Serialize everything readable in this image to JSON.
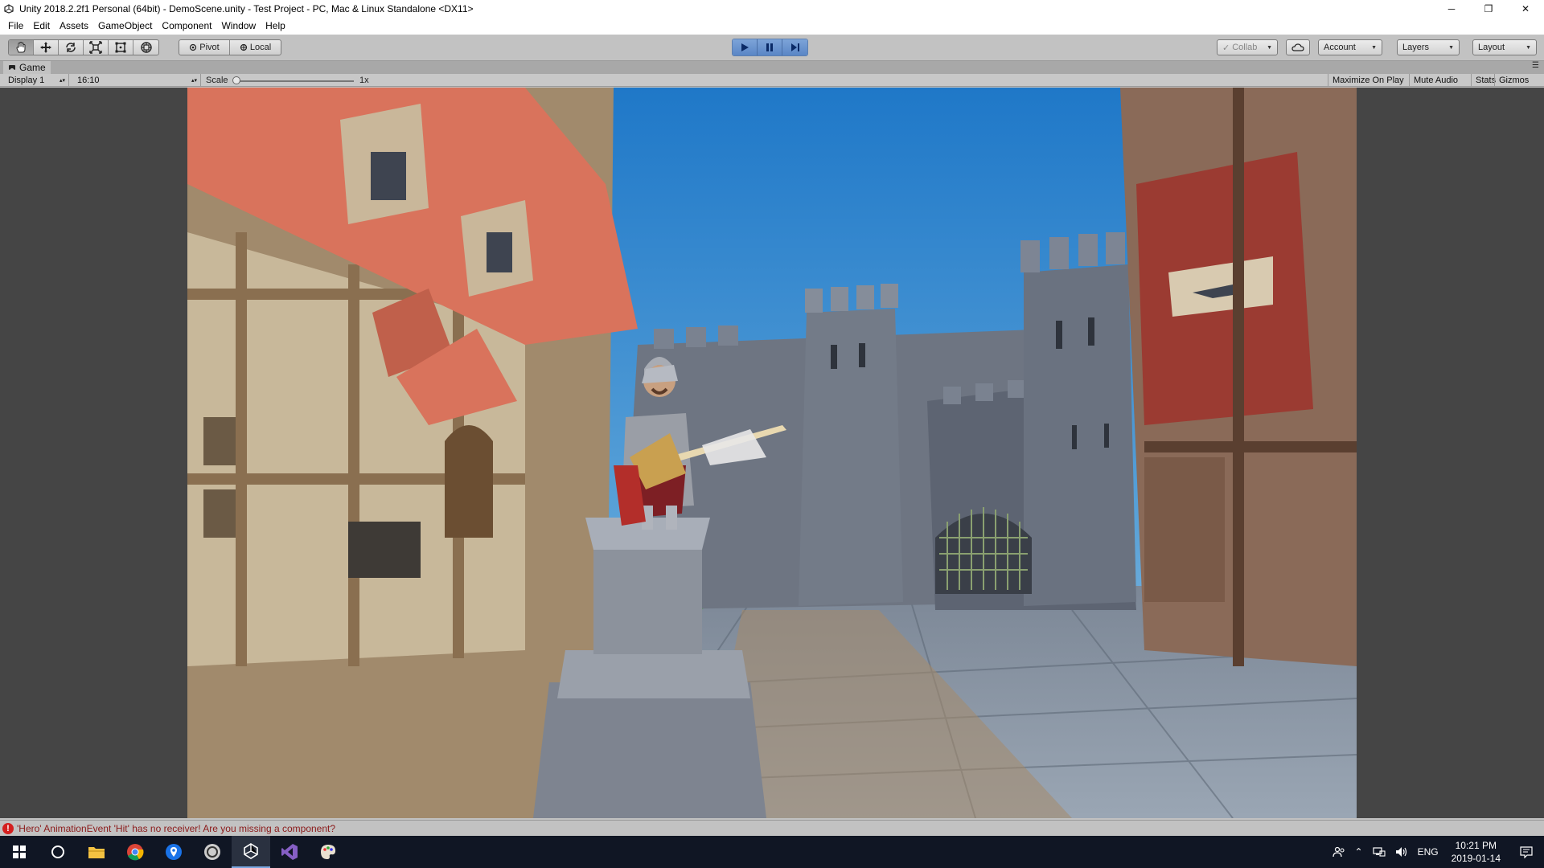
{
  "window": {
    "title": "Unity 2018.2.2f1 Personal (64bit) - DemoScene.unity - Test Project - PC, Mac & Linux Standalone <DX11>",
    "minimize": "─",
    "maximize": "❐",
    "close": "✕"
  },
  "menu": [
    "File",
    "Edit",
    "Assets",
    "GameObject",
    "Component",
    "Window",
    "Help"
  ],
  "toolbar": {
    "pivot_label": "Pivot",
    "local_label": "Local",
    "collab_label": "Collab",
    "account_label": "Account",
    "layers_label": "Layers",
    "layout_label": "Layout"
  },
  "game_tab": {
    "label": "Game",
    "display": "Display 1",
    "aspect": "16:10",
    "scale_label": "Scale",
    "scale_value": "1x",
    "scale_level": 0.0,
    "maximize_on_play": "Maximize On Play",
    "mute_audio": "Mute Audio",
    "stats": "Stats",
    "gizmos": "Gizmos"
  },
  "status": {
    "message": "'Hero' AnimationEvent 'Hit' has no receiver! Are you missing a component?"
  },
  "taskbar": {
    "language": "ENG",
    "time": "10:21 PM",
    "date": "2019-01-14"
  },
  "colors": {
    "sky_top": "#1f78c8",
    "sky_bottom": "#9cc6e0",
    "roof": "#d9735c",
    "stone": "#6e7582",
    "timber": "#a18a6c",
    "play_accent": "#5a86c6",
    "error": "#d42020"
  }
}
